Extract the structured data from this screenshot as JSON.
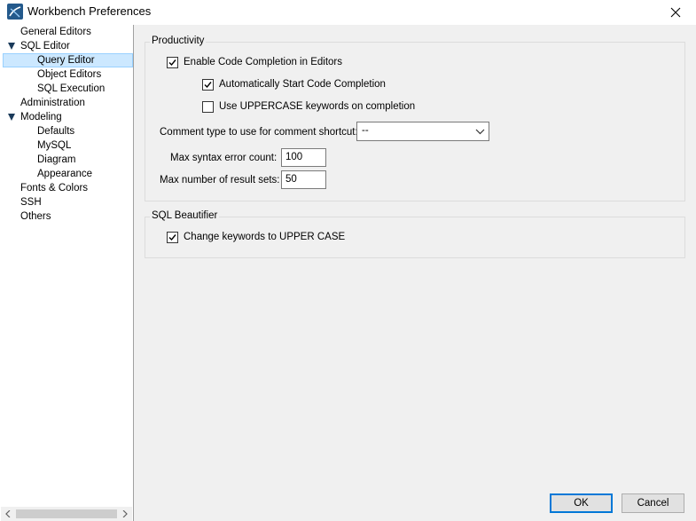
{
  "window": {
    "title": "Workbench Preferences",
    "close_glyph": "close-icon",
    "app_icon": "mysql-workbench-icon"
  },
  "sidebar": {
    "items": [
      {
        "label": "General Editors",
        "level": 1,
        "expanded": null,
        "selected": false
      },
      {
        "label": "SQL Editor",
        "level": 1,
        "expanded": true,
        "selected": false
      },
      {
        "label": "Query Editor",
        "level": 2,
        "expanded": null,
        "selected": true
      },
      {
        "label": "Object Editors",
        "level": 2,
        "expanded": null,
        "selected": false
      },
      {
        "label": "SQL Execution",
        "level": 2,
        "expanded": null,
        "selected": false
      },
      {
        "label": "Administration",
        "level": 1,
        "expanded": null,
        "selected": false
      },
      {
        "label": "Modeling",
        "level": 1,
        "expanded": true,
        "selected": false
      },
      {
        "label": "Defaults",
        "level": 2,
        "expanded": null,
        "selected": false
      },
      {
        "label": "MySQL",
        "level": 2,
        "expanded": null,
        "selected": false
      },
      {
        "label": "Diagram",
        "level": 2,
        "expanded": null,
        "selected": false
      },
      {
        "label": "Appearance",
        "level": 2,
        "expanded": null,
        "selected": false
      },
      {
        "label": "Fonts & Colors",
        "level": 1,
        "expanded": null,
        "selected": false
      },
      {
        "label": "SSH",
        "level": 1,
        "expanded": null,
        "selected": false
      },
      {
        "label": "Others",
        "level": 1,
        "expanded": null,
        "selected": false
      }
    ]
  },
  "productivity": {
    "title": "Productivity",
    "enable_completion": {
      "label": "Enable Code Completion in Editors",
      "checked": true
    },
    "auto_start": {
      "label": "Automatically Start Code Completion",
      "checked": true
    },
    "uppercase_keywords": {
      "label": "Use UPPERCASE keywords on completion",
      "checked": false
    },
    "comment_type": {
      "label": "Comment type to use for comment shortcut:",
      "value": "--"
    },
    "max_syntax_errors": {
      "label": "Max syntax error count:",
      "value": "100"
    },
    "max_result_sets": {
      "label": "Max number of result sets:",
      "value": "50"
    }
  },
  "beautifier": {
    "title": "SQL Beautifier",
    "change_keywords": {
      "label": "Change keywords to UPPER CASE",
      "checked": true
    }
  },
  "buttons": {
    "ok": "OK",
    "cancel": "Cancel"
  },
  "colors": {
    "selection_bg": "#cce8ff",
    "selection_border": "#99d1ff",
    "default_button_border": "#0078d7"
  }
}
